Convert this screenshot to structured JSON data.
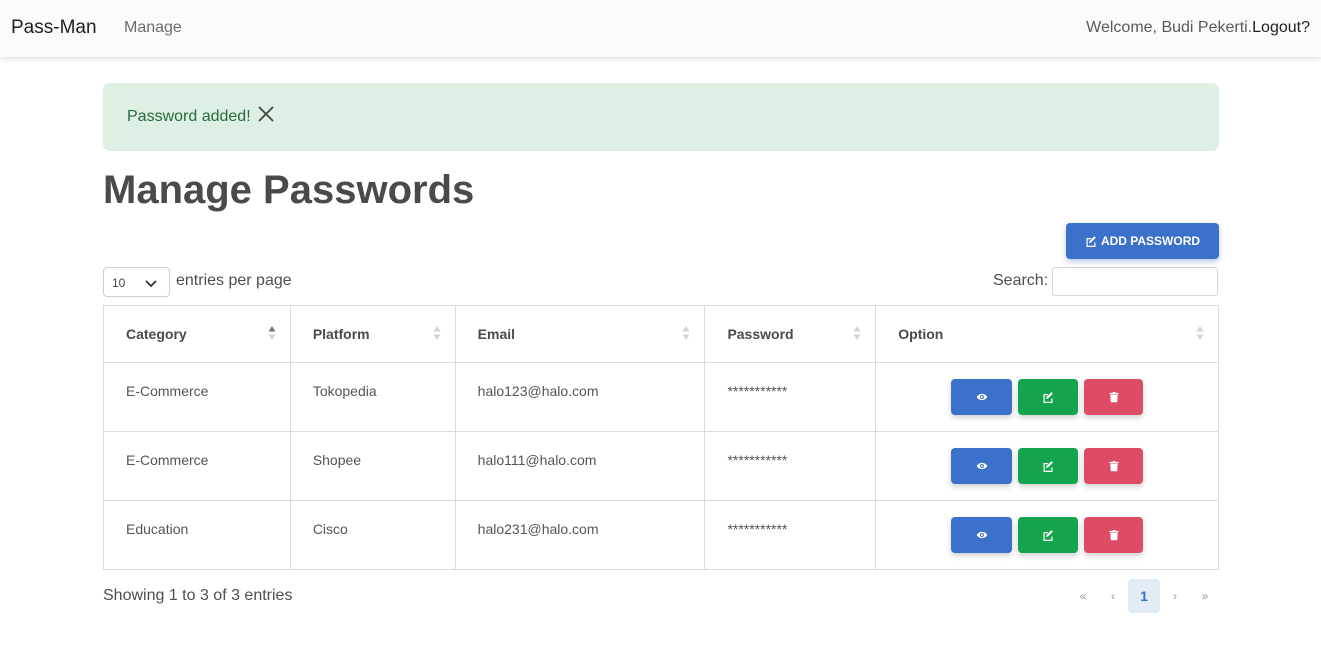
{
  "navbar": {
    "brand": "Pass-Man",
    "manage_link": "Manage",
    "welcome_text": "Welcome, Budi Pekerti.",
    "logout_link": "Logout?"
  },
  "alert": {
    "message": "Password added!"
  },
  "page": {
    "title": "Manage Passwords",
    "add_button": "ADD PASSWORD"
  },
  "controls": {
    "entries_value": "10",
    "entries_label": "entries per page",
    "search_label": "Search:",
    "search_value": ""
  },
  "table": {
    "headers": [
      "Category",
      "Platform",
      "Email",
      "Password",
      "Option"
    ],
    "rows": [
      {
        "category": "E-Commerce",
        "platform": "Tokopedia",
        "email": "halo123@halo.com",
        "password": "***********"
      },
      {
        "category": "E-Commerce",
        "platform": "Shopee",
        "email": "halo111@halo.com",
        "password": "***********"
      },
      {
        "category": "Education",
        "platform": "Cisco",
        "email": "halo231@halo.com",
        "password": "***********"
      }
    ]
  },
  "footer": {
    "showing": "Showing 1 to 3 of 3 entries",
    "pages": [
      "«",
      "‹",
      "1",
      "›",
      "»"
    ]
  },
  "colors": {
    "primary": "#3b71ca",
    "success": "#14a44d",
    "danger": "#dc4c64",
    "alert_bg": "#deefe3"
  }
}
